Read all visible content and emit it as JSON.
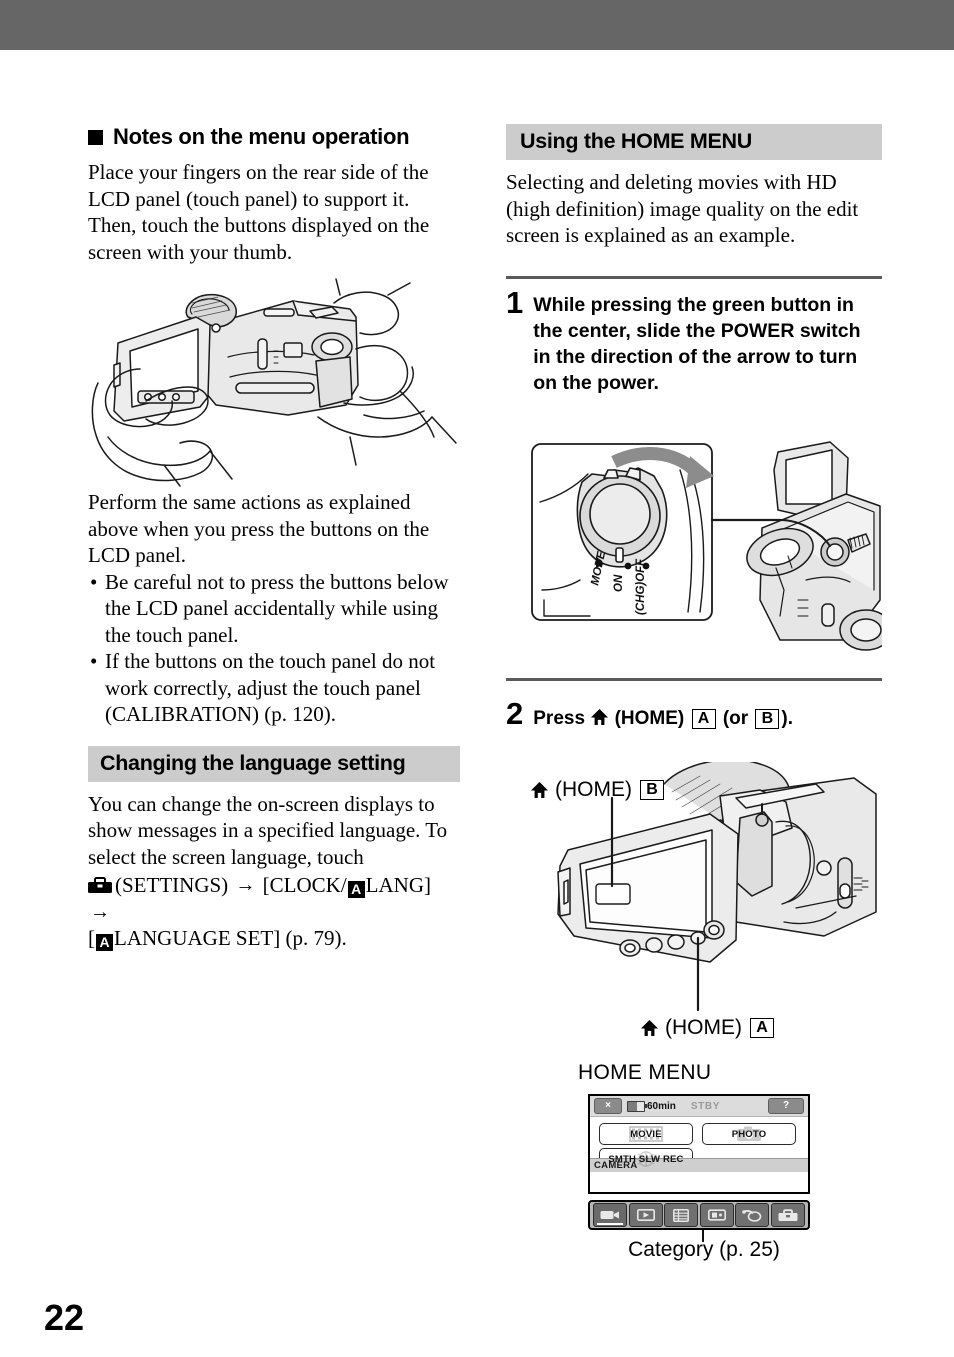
{
  "page": {
    "number": "22",
    "top_band_color": "#666666",
    "heading_bar_color": "#cccccc"
  },
  "left_column": {
    "notes_heading": "Notes on the menu operation",
    "notes_paragraph": "Place your fingers on the rear side of the LCD panel (touch panel) to support it. Then, touch the buttons displayed on the screen with your thumb.",
    "figure_caption_name": "hands-holding-camcorder-illustration",
    "perform_paragraph": "Perform the same actions as explained above when you press the buttons on the LCD panel.",
    "bullets": [
      "Be careful not to press the buttons below the LCD panel accidentally while using the touch panel.",
      "If the buttons on the touch panel do not work correctly, adjust the touch panel (CALIBRATION) (p. 120)."
    ],
    "language_heading": "Changing the language setting",
    "language_paragraph": "You can change the on-screen displays to show messages in a specified language. To select the screen language, touch",
    "language_path": {
      "settings_label": "(SETTINGS)",
      "arrow": "→",
      "clock_bracket_open": "[CLOCK/",
      "a_badge": "A",
      "lang_label": "LANG]",
      "second_bracket_open": "[",
      "language_set_label": "LANGUAGE SET]",
      "page_ref": "(p. 79)."
    }
  },
  "right_column": {
    "home_menu_heading": "Using the HOME MENU",
    "intro_paragraph": "Selecting and deleting movies with HD (high definition) image quality on the edit screen is explained as an example.",
    "steps": [
      {
        "number": "1",
        "text": "While pressing the green button in the center, slide the POWER switch in the direction of the arrow to turn on the power."
      },
      {
        "number": "2",
        "press_label": "Press",
        "home_label": "(HOME)",
        "badge_a": "A",
        "or_label": "(or",
        "badge_b": "B",
        "tail": ")."
      }
    ],
    "power_switch_figure": {
      "mode_label": "MODE",
      "on_label": "ON",
      "off_label": "(CHG)OFF"
    },
    "camera_callouts": {
      "top": {
        "home_label": "(HOME)",
        "badge": "B"
      },
      "bottom": {
        "home_label": "(HOME)",
        "badge": "A"
      }
    },
    "home_menu_screen": {
      "title": "HOME MENU",
      "status_bar": {
        "close_label": "×",
        "battery_minutes": "60",
        "battery_unit": "min",
        "mode": "STBY",
        "help_label": "?"
      },
      "buttons": [
        {
          "label": "MOVIE",
          "icon": "film-strip-icon"
        },
        {
          "label": "PHOTO",
          "icon": "camera-icon"
        },
        {
          "label": "SMTH SLW REC",
          "icon": "slow-motion-icon"
        }
      ],
      "category_label": "CAMERA",
      "category_icons": [
        "camera-category-icon",
        "view-images-category-icon",
        "others-category-icon",
        "manage-media-category-icon",
        "edit-category-icon",
        "settings-category-icon"
      ],
      "caption": "Category (p. 25)"
    }
  }
}
